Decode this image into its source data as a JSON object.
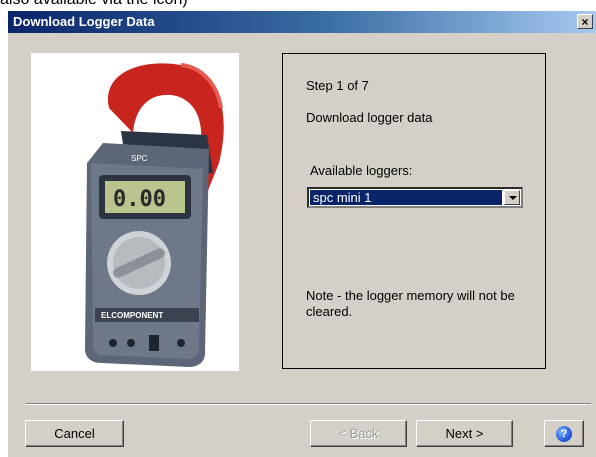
{
  "clipped_top_text": "also available via the icon)",
  "window": {
    "title": "Download Logger Data",
    "close_glyph": "×"
  },
  "photo": {
    "brand": "ELCOMPONENT",
    "display": "0.00",
    "badge": "SPC",
    "icon": "clamp-meter-image"
  },
  "wizard": {
    "step": "Step 1 of 7",
    "description": "Download logger data",
    "available_label": "Available loggers:",
    "selected_logger": "spc mini 1",
    "note": "Note - the logger memory will not be cleared."
  },
  "buttons": {
    "cancel": "Cancel",
    "back": "< Back",
    "next": "Next >",
    "help_glyph": "?"
  },
  "colors": {
    "title_bar": "#0a246a",
    "dialog_face": "#d4d0c8",
    "selection": "#0a246a",
    "clamp_red": "#c8251f"
  }
}
